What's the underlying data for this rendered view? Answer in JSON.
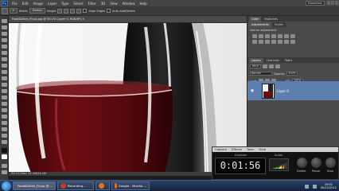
{
  "menubar": {
    "app_icon": "Ps",
    "items": [
      "File",
      "Edit",
      "Image",
      "Layer",
      "Type",
      "Select",
      "Filter",
      "3D",
      "View",
      "Window",
      "Help"
    ],
    "workspace": "Essentials"
  },
  "options": {
    "labels": [
      "Width:",
      "Radius",
      "Height",
      "Align Edges",
      "Auto-Add/Delete"
    ]
  },
  "document": {
    "tab": "Food&Drink_Flyup.jpg @ 50.1% (Layer 0, RGB/8*) ×",
    "status": "50.1%   Doc: 12.1M/24.1M"
  },
  "panels": {
    "top_tabs": [
      "Color",
      "Swatches"
    ],
    "adjust_tabs": [
      "Adjustments",
      "Styles"
    ],
    "add_adjustment_label": "Add an adjustment",
    "layers_tabs": [
      "Layers",
      "Channels",
      "Paths"
    ],
    "kind_label": "Kind",
    "blend_mode": "Normal",
    "opacity_label": "Opacity:",
    "opacity_value": "100%",
    "lock_label": "Lock:",
    "fill_label": "Fill:",
    "fill_value": "100%",
    "layer_name": "Layer 0"
  },
  "recorder": {
    "menu": [
      "Capture",
      "Effects",
      "Tools",
      "Help"
    ],
    "duration_label": "Duration",
    "audio_label": "Audio",
    "time": "0:01:56",
    "buttons": [
      "Delete",
      "Pause",
      "Stop"
    ]
  },
  "taskbar": {
    "tasks": [
      {
        "label": "Food&Drink_Flyup @ ...",
        "color": "#1c4d8a"
      },
      {
        "label": "Recording...",
        "color": "#c0392b"
      },
      {
        "label": "",
        "color": "#e8731a"
      },
      {
        "label": "Google - Mozilla ...",
        "color": "#e8731a"
      }
    ],
    "time": "19:01",
    "date": "05/12/2012"
  },
  "colors": {
    "wine": "#5a0b0d",
    "layer_selected": "#5d7fb0",
    "taskbar": "#1f3152"
  }
}
